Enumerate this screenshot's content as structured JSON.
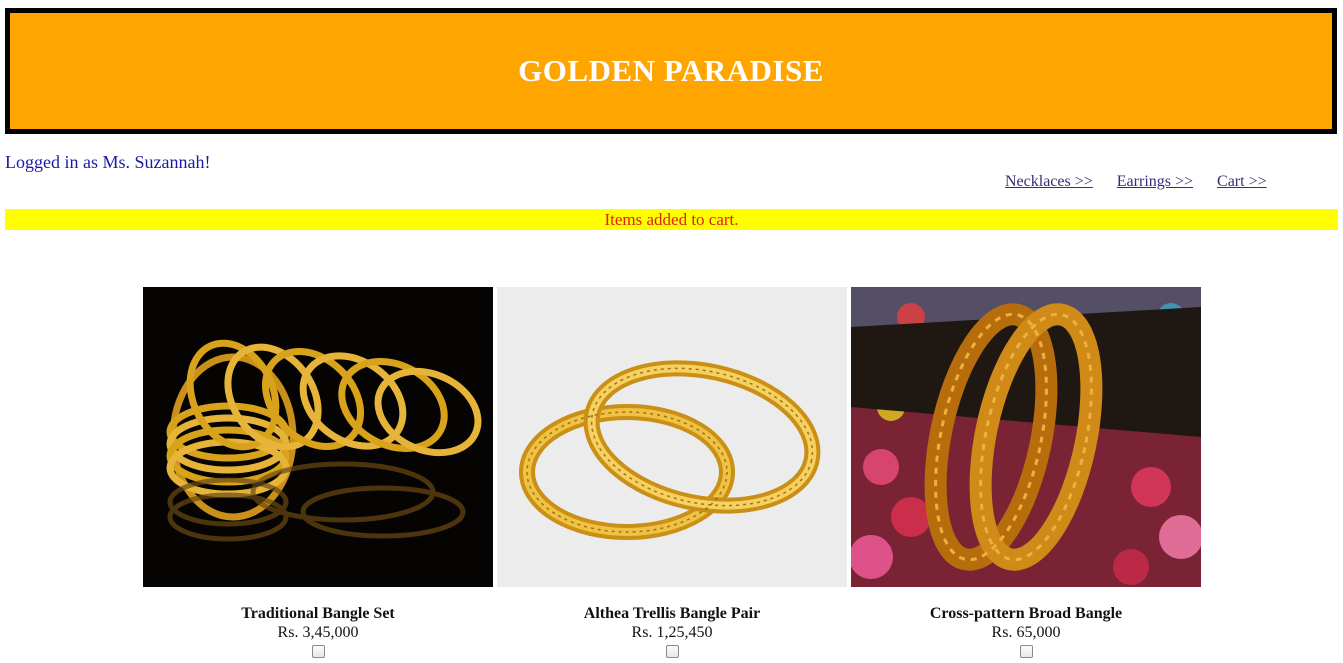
{
  "header": {
    "title": "GOLDEN PARADISE"
  },
  "user": {
    "status": "Logged in as Ms. Suzannah!"
  },
  "nav": {
    "links": [
      "Necklaces >>",
      "Earrings >>",
      "Cart >>"
    ]
  },
  "notice": {
    "text": "Items added to cart."
  },
  "products": [
    {
      "name": "Traditional Bangle Set",
      "price": "Rs. 3,45,000",
      "checked": false
    },
    {
      "name": "Althea Trellis Bangle Pair",
      "price": "Rs. 1,25,450",
      "checked": false
    },
    {
      "name": "Cross-pattern Broad Bangle",
      "price": "Rs. 65,000",
      "checked": false
    }
  ],
  "colors": {
    "banner": "#FFA500",
    "notice_bg": "#FFFF00",
    "notice_text": "#e0201a",
    "gold": "#d9a21b"
  }
}
